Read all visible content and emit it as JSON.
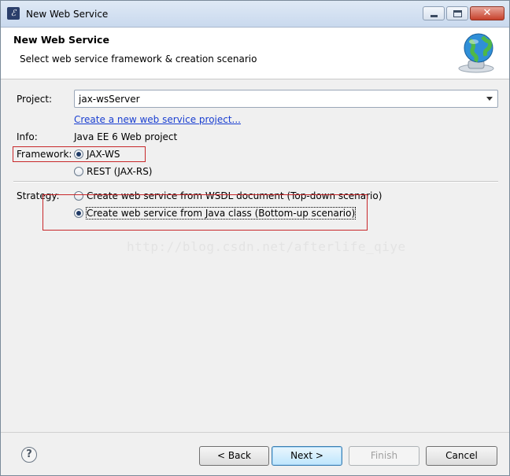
{
  "window": {
    "title": "New Web Service",
    "close_glyph": "✕"
  },
  "banner": {
    "title": "New Web Service",
    "description": "Select web service framework & creation scenario"
  },
  "form": {
    "project_label": "Project:",
    "project_value": "jax-wsServer",
    "create_link": "Create a new web service project...",
    "info_label": "Info:",
    "info_value": "Java EE 6 Web project",
    "framework_label": "Framework:",
    "framework_options": [
      {
        "label": "JAX-WS",
        "checked": true
      },
      {
        "label": "REST (JAX-RS)",
        "checked": false
      }
    ],
    "strategy_label": "Strategy:",
    "strategy_options": [
      {
        "label": "Create web service from WSDL document (Top-down scenario)",
        "checked": false
      },
      {
        "label": "Create web service from Java class (Bottom-up scenario)",
        "checked": true
      }
    ]
  },
  "watermark": "http://blog.csdn.net/afterlife_qiye",
  "buttons": {
    "help": "?",
    "back": "< Back",
    "next": "Next >",
    "finish": "Finish",
    "cancel": "Cancel"
  },
  "colors": {
    "annotation": "#c8282a",
    "link": "#1a3fd1"
  }
}
